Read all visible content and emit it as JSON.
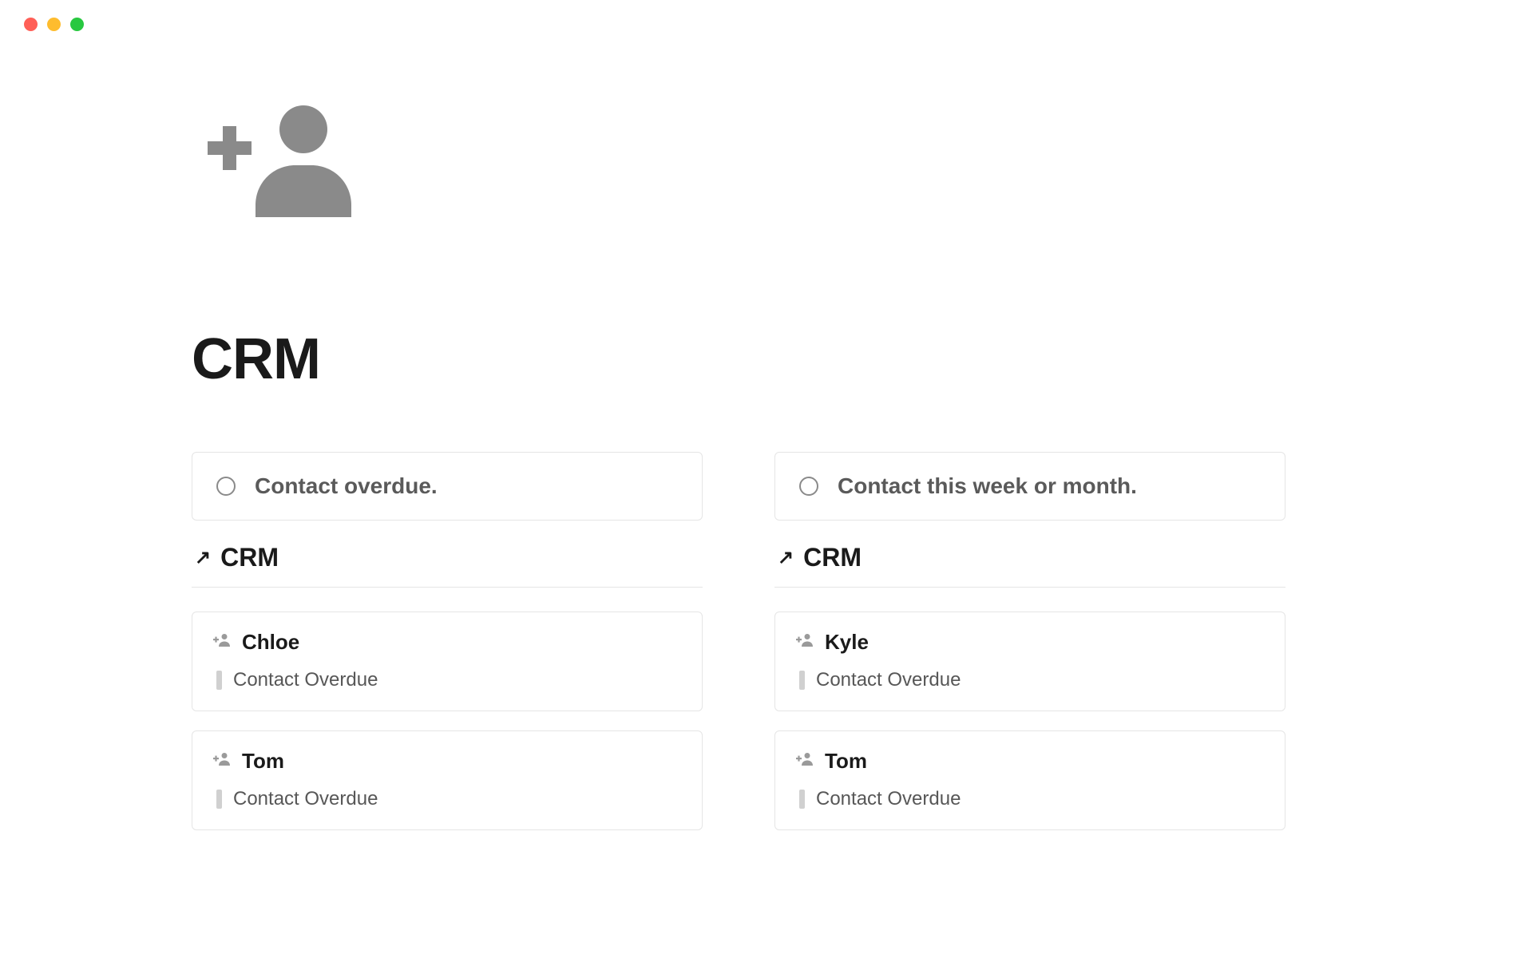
{
  "page": {
    "title": "CRM"
  },
  "columns": [
    {
      "todo": "Contact overdue.",
      "db_title": "CRM",
      "cards": [
        {
          "name": "Chloe",
          "status": "Contact Overdue"
        },
        {
          "name": "Tom",
          "status": "Contact Overdue"
        }
      ]
    },
    {
      "todo": "Contact this week or month.",
      "db_title": "CRM",
      "cards": [
        {
          "name": "Kyle",
          "status": "Contact Overdue"
        },
        {
          "name": "Tom",
          "status": "Contact Overdue"
        }
      ]
    }
  ]
}
